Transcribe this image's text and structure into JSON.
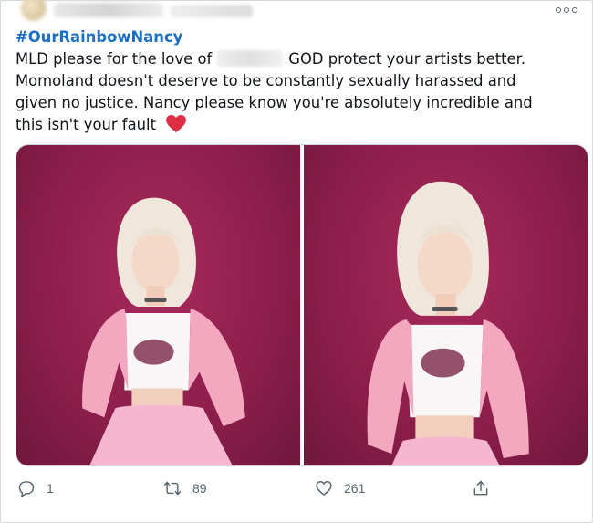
{
  "tweet": {
    "hashtag": "#OurRainbowNancy",
    "line1_a": "MLD please for the love of",
    "line1_b": "GOD protect your artists better.",
    "line2": "Momoland doesn't deserve to be constantly sexually harassed and",
    "line3": "given no justice. Nancy please know you're absolutely incredible and",
    "line4": "this isn't your fault",
    "emoji": "red-heart"
  },
  "media": {
    "photos": [
      {
        "description_icon": "photo-1"
      },
      {
        "description_icon": "photo-2"
      }
    ],
    "background_color": "#8e1f4c"
  },
  "actions": {
    "reply_count": "1",
    "retweet_count": "89",
    "like_count": "261"
  },
  "icons": {
    "more": "more-options-icon",
    "reply": "reply-icon",
    "retweet": "retweet-icon",
    "like": "heart-icon",
    "share": "share-icon"
  },
  "colors": {
    "hashtag": "#1d6fc4",
    "text": "#0f1419",
    "muted": "#536471",
    "heart": "#e0245e"
  }
}
